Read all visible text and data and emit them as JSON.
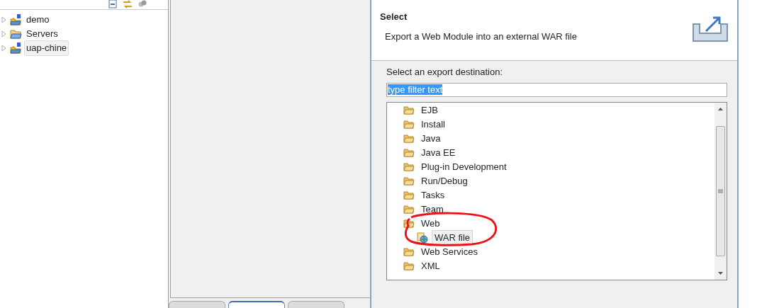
{
  "project_explorer": {
    "items": [
      {
        "label": "demo",
        "kind": "project",
        "selected": false
      },
      {
        "label": "Servers",
        "kind": "folder",
        "selected": false
      },
      {
        "label": "uap-chine",
        "kind": "project",
        "selected": true
      }
    ]
  },
  "bottom_tabs": [
    {
      "selected": false
    },
    {
      "selected": true
    },
    {
      "selected": false
    }
  ],
  "dialog": {
    "title": "Select",
    "description": "Export a Web Module into an external WAR file",
    "destination_label": "Select an export destination:",
    "filter": {
      "value": "type filter text",
      "text_selected": true
    },
    "tree": [
      {
        "label": "EJB",
        "selected": false
      },
      {
        "label": "Install",
        "selected": false
      },
      {
        "label": "Java",
        "selected": false
      },
      {
        "label": "Java EE",
        "selected": false
      },
      {
        "label": "Plug-in Development",
        "selected": false
      },
      {
        "label": "Run/Debug",
        "selected": false
      },
      {
        "label": "Tasks",
        "selected": false
      },
      {
        "label": "Team",
        "selected": false
      },
      {
        "label": "Web",
        "selected": false,
        "children": [
          {
            "label": "WAR file",
            "selected": true
          }
        ]
      },
      {
        "label": "Web Services",
        "selected": false
      },
      {
        "label": "XML",
        "selected": false
      }
    ]
  }
}
